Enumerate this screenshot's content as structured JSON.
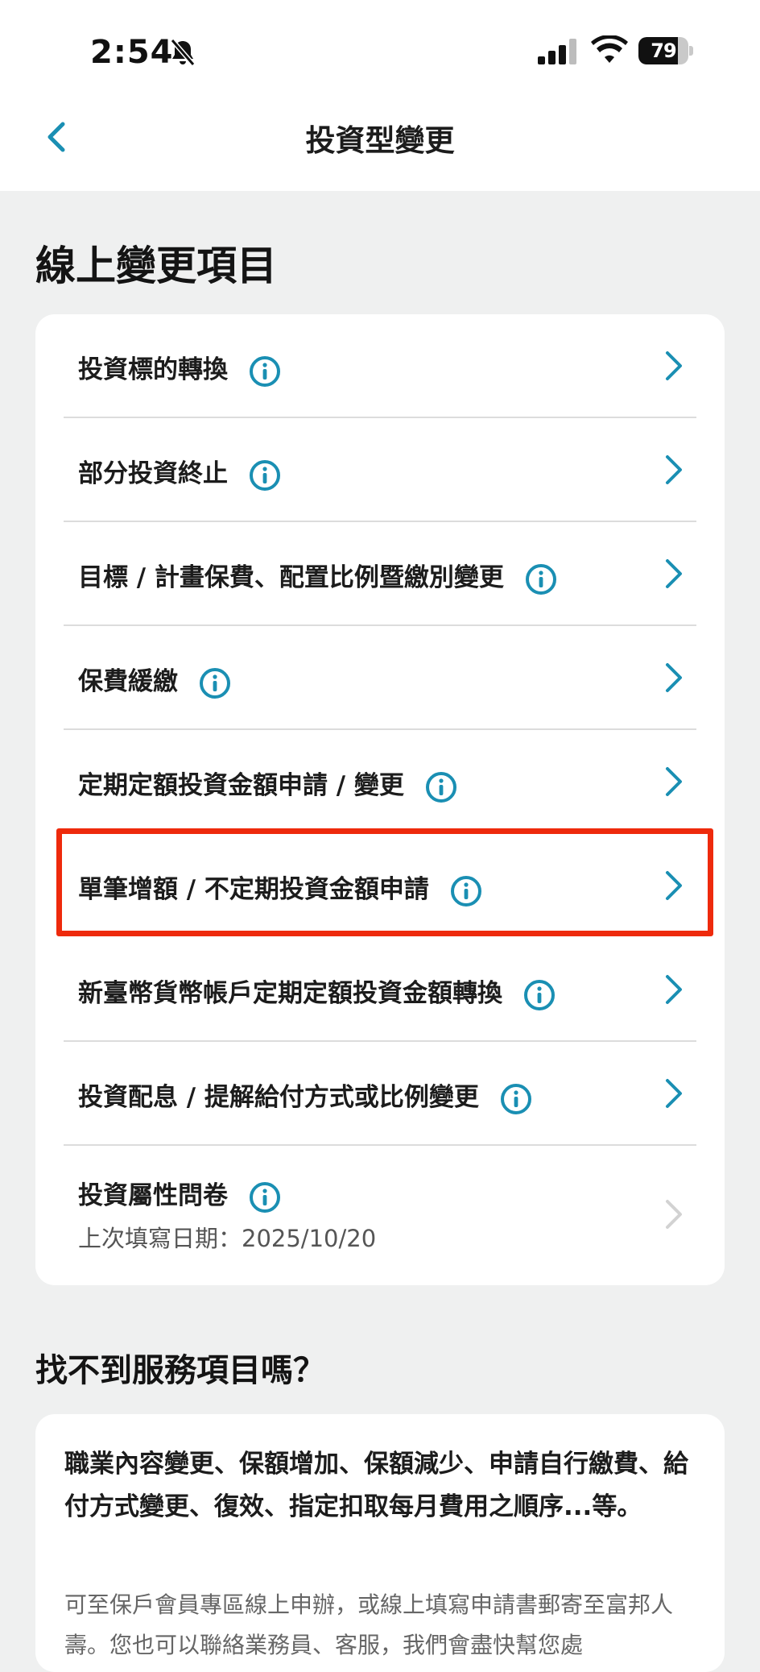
{
  "status_bar": {
    "time": "2:54",
    "battery_level": "79",
    "battery_fraction": 0.79
  },
  "nav": {
    "title": "投資型變更",
    "back_icon": "chevron-left-icon",
    "accent_color": "#1a8fb3"
  },
  "online_section": {
    "title": "線上變更項目",
    "items": [
      {
        "label": "投資標的轉換",
        "icon": "info-icon",
        "enabled": true
      },
      {
        "label": "部分投資終止",
        "icon": "info-icon",
        "enabled": true
      },
      {
        "label": "目標 / 計畫保費、配置比例暨繳別變更",
        "icon": "info-icon",
        "enabled": true
      },
      {
        "label": "保費緩繳",
        "icon": "info-icon",
        "enabled": true
      },
      {
        "label": "定期定額投資金額申請 / 變更",
        "icon": "info-icon",
        "enabled": true
      },
      {
        "label": "單筆增額 / 不定期投資金額申請",
        "icon": "info-icon",
        "enabled": true,
        "highlighted": true
      },
      {
        "label": "新臺幣貨幣帳戶定期定額投資金額轉換",
        "icon": "info-icon",
        "enabled": true
      },
      {
        "label": "投資配息 / 提解給付方式或比例變更",
        "icon": "info-icon",
        "enabled": true
      },
      {
        "label": "投資屬性問卷",
        "sub": "上次填寫日期：2025/10/20",
        "icon": "info-icon",
        "enabled": false
      }
    ],
    "highlight_color": "#ee2a0c"
  },
  "help_section": {
    "title": "找不到服務項目嗎？",
    "main_text": "職業內容變更、保額增加、保額減少、申請自行繳費、給付方式變更、復效、指定扣取每月費用之順序...等。",
    "sub_text": "可至保戶會員專區線上申辦，或線上填寫申請書郵寄至富邦人壽。您也可以聯絡業務員、客服，我們會盡快幫您處"
  }
}
